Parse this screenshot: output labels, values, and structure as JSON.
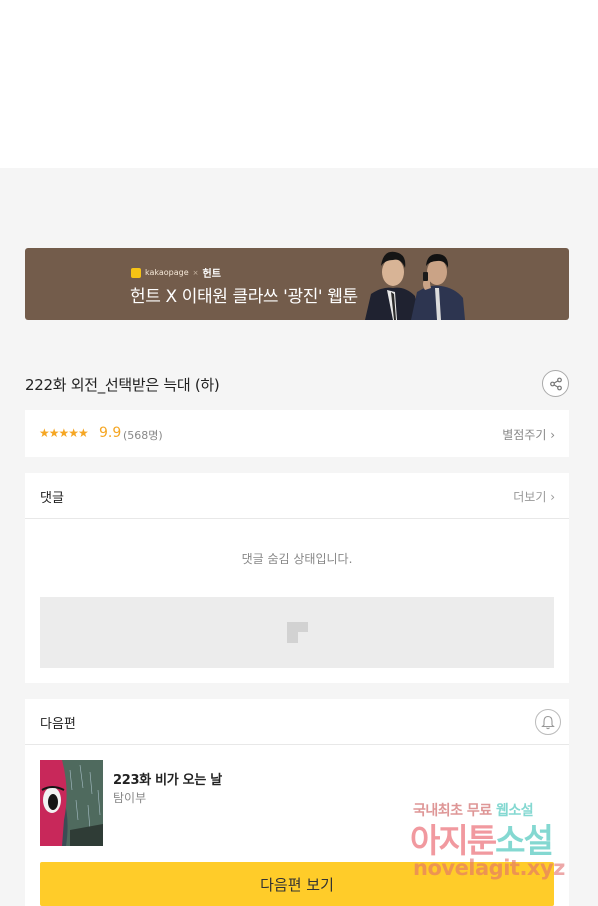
{
  "banner": {
    "brand_logo_text": "kakaopage",
    "brand_separator": "×",
    "brand_partner": "헌트",
    "headline": "헌트 X 이태원 클라쓰 '광진' 웹툰",
    "brand_color": "#735c4b"
  },
  "episode": {
    "title": "222화 외전_선택받은 늑대 (하)",
    "share_icon": "share-icon"
  },
  "rating": {
    "stars": "★★★★★",
    "score": "9.9",
    "count": "(568명)",
    "rate_link": "별점주기 ›",
    "star_color": "#f5a623"
  },
  "comments": {
    "title": "댓글",
    "more_link": "더보기 ›",
    "hidden_message": "댓글 숨김 상태입니다."
  },
  "next_episode": {
    "section_title": "다음편",
    "bell_icon": "bell-icon",
    "title": "223화 비가 오는 날",
    "author": "탐이부",
    "button_label": "다음편 보기",
    "button_color": "#ffcc29"
  },
  "watermark": {
    "line1_a": "국내최초 무료",
    "line1_b": "웹소설",
    "line2_a": "아지툰",
    "line2_b": "소설",
    "line3": "novelagit.xyz"
  }
}
